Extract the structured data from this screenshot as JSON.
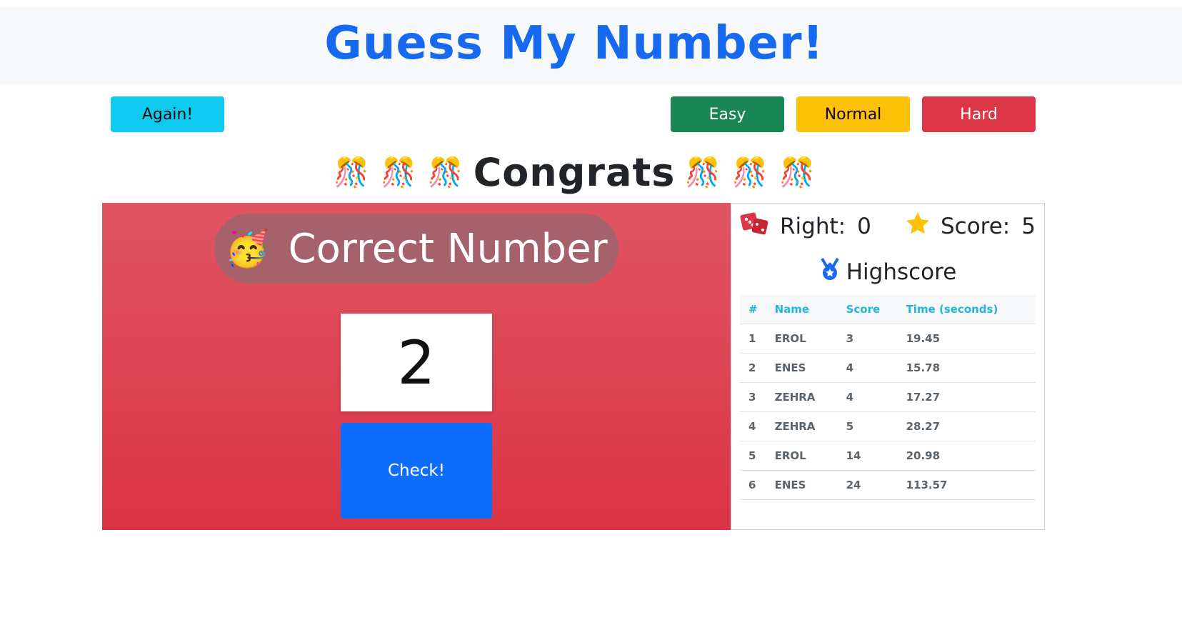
{
  "header": {
    "title": "Guess My Number!"
  },
  "controls": {
    "again_label": "Again!",
    "easy_label": "Easy",
    "normal_label": "Normal",
    "hard_label": "Hard"
  },
  "congrats": {
    "text": "Congrats",
    "emoji": "🎊"
  },
  "game": {
    "message": "Correct Number",
    "message_emoji": "🥳",
    "number": "2",
    "check_label": "Check!"
  },
  "stats": {
    "right_label": "Right:",
    "right_value": "0",
    "score_label": "Score:",
    "score_value": "5",
    "right_icon": "dice-icon",
    "score_icon": "star-icon"
  },
  "highscore": {
    "title": "Highscore",
    "icon": "medal-icon",
    "columns": [
      "#",
      "Name",
      "Score",
      "Time (seconds)"
    ],
    "rows": [
      [
        "1",
        "EROL",
        "3",
        "19.45"
      ],
      [
        "2",
        "ENES",
        "4",
        "15.78"
      ],
      [
        "3",
        "ZEHRA",
        "4",
        "17.27"
      ],
      [
        "4",
        "ZEHRA",
        "5",
        "28.27"
      ],
      [
        "5",
        "EROL",
        "14",
        "20.98"
      ],
      [
        "6",
        "ENES",
        "24",
        "113.57"
      ]
    ]
  },
  "colors": {
    "brand": "#1769ef",
    "again": "#0fcaf0",
    "easy": "#198754",
    "normal": "#ffc107",
    "hard": "#dc3545",
    "panel_bg": "#db3343",
    "check": "#0d6efd"
  }
}
